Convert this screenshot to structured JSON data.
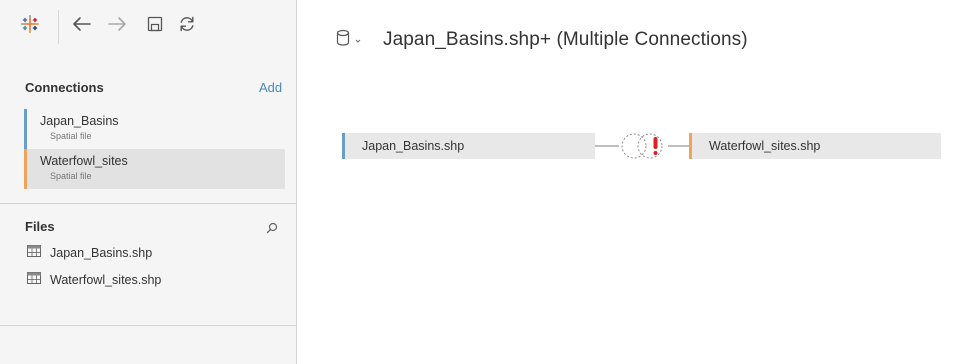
{
  "colors": {
    "sidebar_bg": "#f5f5f5",
    "japan_accent": "#6a9dc8",
    "waterfowl_accent": "#f0a35b",
    "link": "#4a8ab5",
    "join_warning": "#e02020"
  },
  "toolbar": {
    "icons": [
      "tableau-logo-icon",
      "back-arrow-icon",
      "forward-arrow-icon",
      "save-icon",
      "refresh-icon"
    ]
  },
  "connections": {
    "title": "Connections",
    "add_label": "Add",
    "items": [
      {
        "name": "Japan_Basins",
        "type": "Spatial file",
        "accent": "#6a9dc8",
        "selected": false
      },
      {
        "name": "Waterfowl_sites",
        "type": "Spatial file",
        "accent": "#f0a35b",
        "selected": true
      }
    ]
  },
  "files": {
    "title": "Files",
    "items": [
      {
        "name": "Japan_Basins.shp",
        "icon": "table-icon"
      },
      {
        "name": "Waterfowl_sites.shp",
        "icon": "table-icon"
      }
    ]
  },
  "datasource": {
    "title": "Japan_Basins.shp+ (Multiple Connections)",
    "icon": "database-icon"
  },
  "canvas": {
    "left_table": "Japan_Basins.shp",
    "right_table": "Waterfowl_sites.shp",
    "join_icon": "join-warning-icon"
  }
}
